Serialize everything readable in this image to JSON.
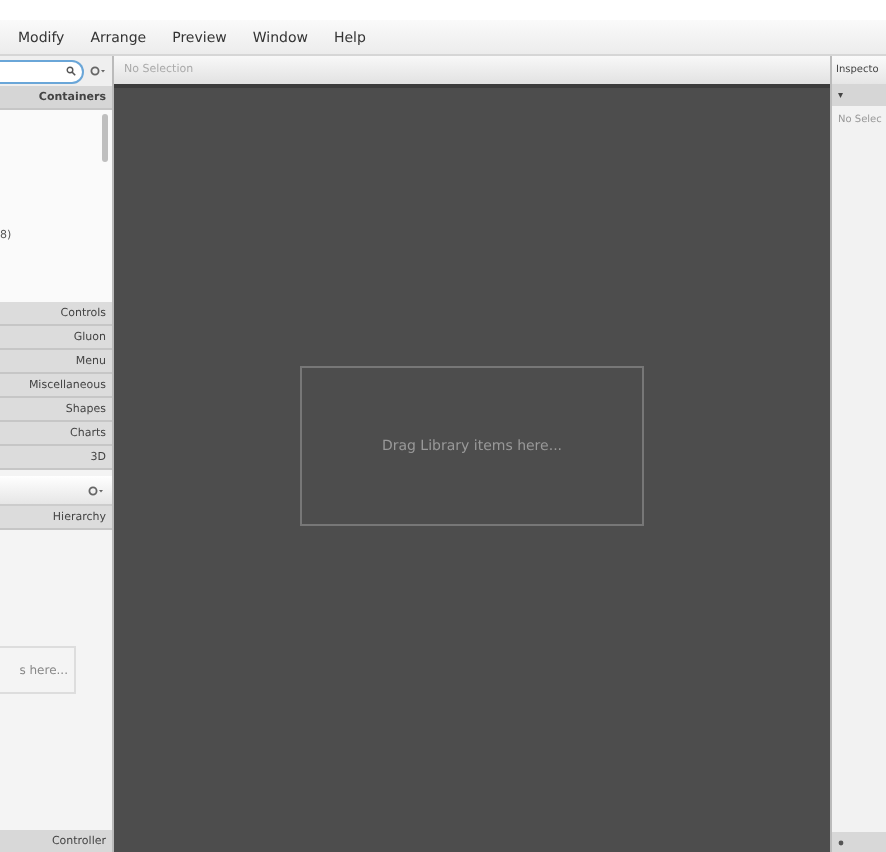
{
  "menu_bar": {
    "items": [
      "Modify",
      "Arrange",
      "Preview",
      "Window",
      "Help"
    ]
  },
  "library": {
    "sections": [
      {
        "label": "Containers",
        "expanded": true
      },
      {
        "label": "Controls",
        "expanded": false
      },
      {
        "label": "Gluon",
        "expanded": false
      },
      {
        "label": "Menu",
        "expanded": false
      },
      {
        "label": "Miscellaneous",
        "expanded": false
      },
      {
        "label": "Shapes",
        "expanded": false
      },
      {
        "label": "Charts",
        "expanded": false
      },
      {
        "label": "3D",
        "expanded": false
      }
    ],
    "list_fragment": "8)"
  },
  "document": {
    "header": "Hierarchy",
    "drop_hint": "s here...",
    "footer": "Controller"
  },
  "canvas": {
    "breadcrumb": "No Selection",
    "drop_hint": "Drag Library items here..."
  },
  "inspector": {
    "title": "Inspecto",
    "toggle": "▾",
    "status": "No Selec"
  }
}
